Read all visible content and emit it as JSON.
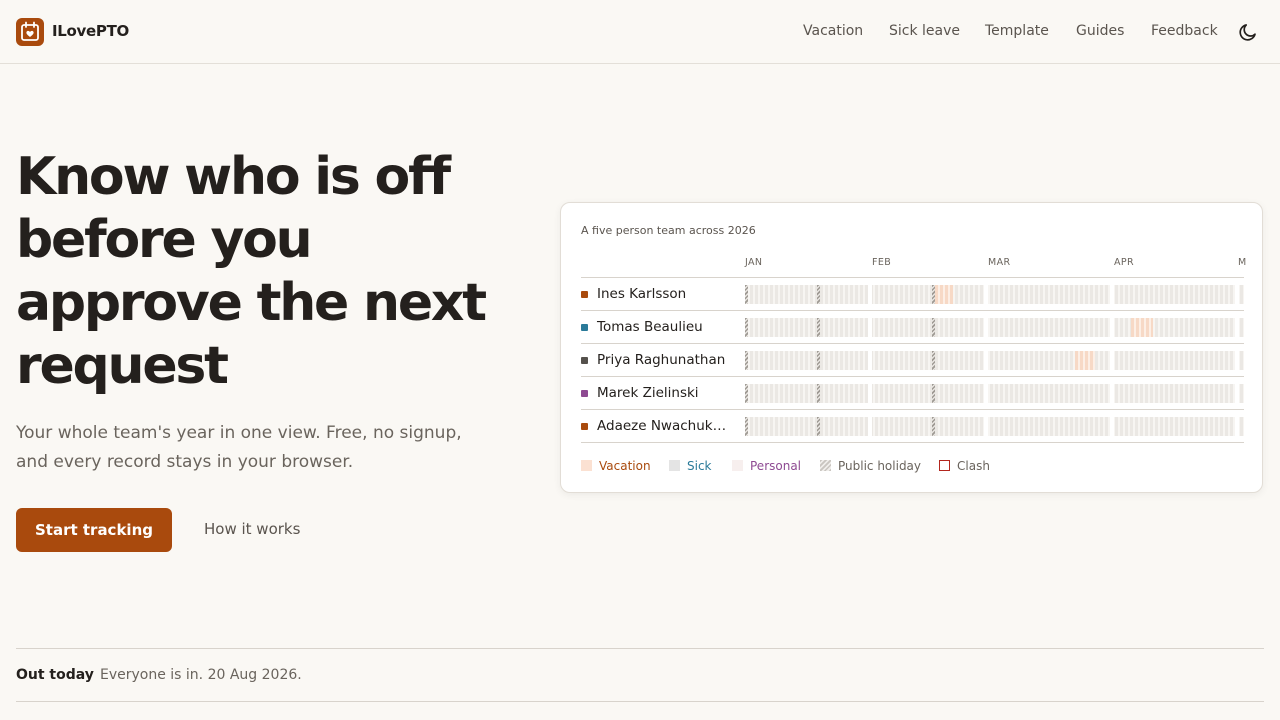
{
  "brand": {
    "name": "ILovePTO",
    "logo_icon": "calendar-heart-icon",
    "color": "#a94a0d"
  },
  "nav": {
    "items": [
      {
        "label": "Vacation"
      },
      {
        "label": "Sick leave"
      },
      {
        "label": "Template"
      },
      {
        "label": "Guides"
      },
      {
        "label": "Feedback"
      }
    ],
    "theme_icon": "moon-icon"
  },
  "hero": {
    "title": "Know who is off before you approve the next request",
    "subtitle": "Your whole team's year in one view. Free, no signup, and every record stays in your browser.",
    "primary_cta": "Start tracking",
    "secondary_cta": "How it works"
  },
  "preview": {
    "title": "A five person team across 2026",
    "months": [
      "JAN",
      "FEB",
      "MAR",
      "APR",
      "M"
    ],
    "people": [
      {
        "name": "Ines Karlsson",
        "color": "#a94a0d"
      },
      {
        "name": "Tomas Beaulieu",
        "color": "#2a7a99"
      },
      {
        "name": "Priya Raghunathan",
        "color": "#55514c"
      },
      {
        "name": "Marek Zielinski",
        "color": "#8e4a92"
      },
      {
        "name": "Adaeze Nwachuk…",
        "color": "#a94a0d"
      }
    ],
    "legend": [
      {
        "label": "Vacation",
        "color": "#a94a0d"
      },
      {
        "label": "Sick",
        "color": "#2a7a99"
      },
      {
        "label": "Personal",
        "color": "#8e4a92"
      },
      {
        "label": "Public holiday",
        "color": "#6a645d"
      },
      {
        "label": "Clash",
        "color": "#6a645d"
      }
    ]
  },
  "status": {
    "label": "Out today",
    "text": "Everyone is in. 20 Aug 2026."
  },
  "colors": {
    "accent": "#a94a0d",
    "background": "#faf8f4",
    "clash": "#b3261e"
  }
}
